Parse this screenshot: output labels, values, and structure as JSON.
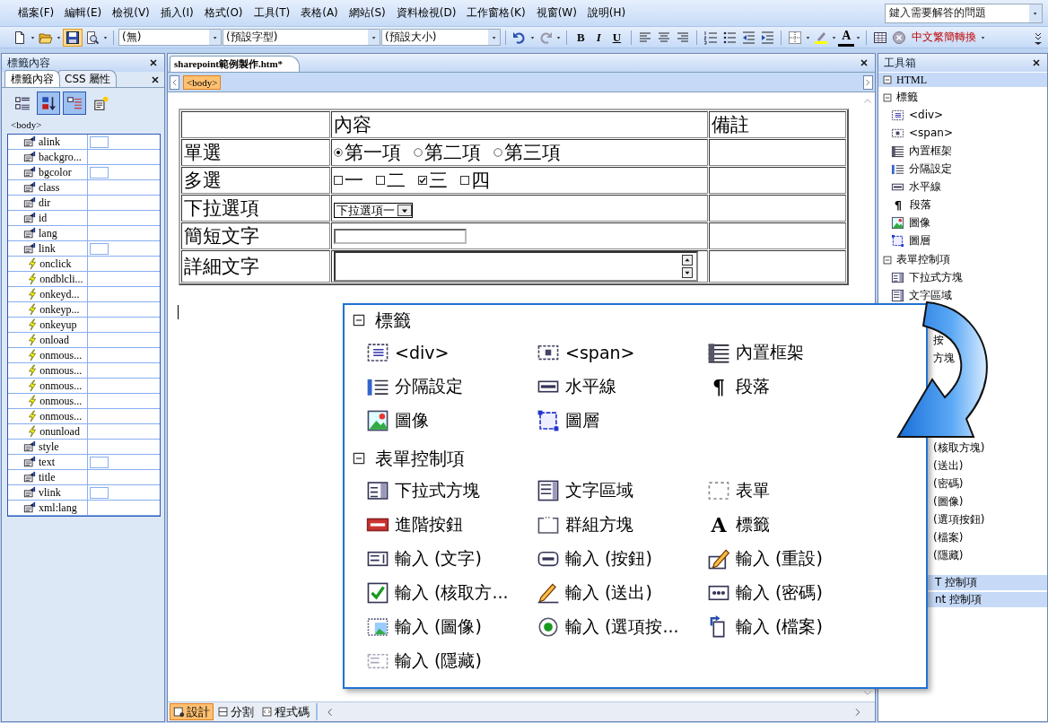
{
  "menu_bar": {
    "items": [
      "檔案(F)",
      "編輯(E)",
      "檢視(V)",
      "插入(I)",
      "格式(O)",
      "工具(T)",
      "表格(A)",
      "網站(S)",
      "資料檢視(D)",
      "工作窗格(K)",
      "視窗(W)",
      "說明(H)"
    ]
  },
  "help_search": {
    "placeholder": "鍵入需要解答的問題"
  },
  "toolbar": {
    "items": [
      {
        "kind": "new",
        "highlighted": false
      },
      {
        "kind": "caret"
      },
      {
        "kind": "open",
        "highlighted": false
      },
      {
        "kind": "caret"
      },
      {
        "kind": "save",
        "highlighted": true
      },
      {
        "kind": "preview",
        "highlighted": false
      },
      {
        "kind": "caret"
      },
      {
        "kind": "separator"
      },
      {
        "kind": "style_combo",
        "text": "(無)"
      },
      {
        "kind": "font_combo",
        "text": "(預設字型)"
      },
      {
        "kind": "size_combo",
        "text": "(預設大小)"
      },
      {
        "kind": "separator"
      },
      {
        "kind": "undo",
        "highlighted": false
      },
      {
        "kind": "caret"
      },
      {
        "kind": "redo",
        "highlighted": false
      },
      {
        "kind": "caret"
      },
      {
        "kind": "separator"
      },
      {
        "kind": "bold",
        "text": "B",
        "highlighted": false
      },
      {
        "kind": "italic",
        "text": "I",
        "highlighted": false
      },
      {
        "kind": "underline",
        "text": "U",
        "highlighted": false
      },
      {
        "kind": "separator"
      },
      {
        "kind": "align_left",
        "highlighted": false
      },
      {
        "kind": "align_center",
        "highlighted": false
      },
      {
        "kind": "align_right",
        "highlighted": false
      },
      {
        "kind": "separator"
      },
      {
        "kind": "numbering",
        "highlighted": false
      },
      {
        "kind": "bullets",
        "highlighted": false
      },
      {
        "kind": "outdent",
        "highlighted": false
      },
      {
        "kind": "indent",
        "highlighted": false
      },
      {
        "kind": "separator"
      },
      {
        "kind": "borders",
        "highlighted": false
      },
      {
        "kind": "caret"
      },
      {
        "kind": "highlight",
        "highlighted": false
      },
      {
        "kind": "caret"
      },
      {
        "kind": "font_color",
        "text": "A",
        "highlighted": false
      },
      {
        "kind": "caret"
      },
      {
        "kind": "separator"
      },
      {
        "kind": "table",
        "highlighted": false
      },
      {
        "kind": "stop",
        "highlighted": false
      },
      {
        "kind": "convert",
        "text": "中文繁簡轉換",
        "highlighted": false
      },
      {
        "kind": "caret"
      }
    ]
  },
  "tag_properties_panel": {
    "title": "標籤內容",
    "tabs": [
      {
        "label": "標籤內容",
        "selected": true
      },
      {
        "label": "CSS 屬性",
        "selected": false
      }
    ],
    "tools": [
      {
        "kind": "categorized",
        "selected": false
      },
      {
        "kind": "sort_az",
        "selected": true
      },
      {
        "kind": "show_set",
        "selected": true
      },
      {
        "kind": "tag_properties",
        "selected": false
      }
    ],
    "current_tag": "<body>",
    "properties": [
      {
        "name": "alink",
        "kind": "color"
      },
      {
        "name": "backgro...",
        "kind": "attribute"
      },
      {
        "name": "bgcolor",
        "kind": "color"
      },
      {
        "name": "class",
        "kind": "attribute"
      },
      {
        "name": "dir",
        "kind": "attribute"
      },
      {
        "name": "id",
        "kind": "attribute"
      },
      {
        "name": "lang",
        "kind": "attribute"
      },
      {
        "name": "link",
        "kind": "color"
      },
      {
        "name": "onclick",
        "kind": "event"
      },
      {
        "name": "ondblcli...",
        "kind": "event"
      },
      {
        "name": "onkeyd...",
        "kind": "event"
      },
      {
        "name": "onkeyp...",
        "kind": "event"
      },
      {
        "name": "onkeyup",
        "kind": "event"
      },
      {
        "name": "onload",
        "kind": "event"
      },
      {
        "name": "onmous...",
        "kind": "event"
      },
      {
        "name": "onmous...",
        "kind": "event"
      },
      {
        "name": "onmous...",
        "kind": "event"
      },
      {
        "name": "onmous...",
        "kind": "event"
      },
      {
        "name": "onmous...",
        "kind": "event"
      },
      {
        "name": "onunload",
        "kind": "event"
      },
      {
        "name": "style",
        "kind": "attribute"
      },
      {
        "name": "text",
        "kind": "color"
      },
      {
        "name": "title",
        "kind": "attribute"
      },
      {
        "name": "vlink",
        "kind": "color"
      },
      {
        "name": "xml:lang",
        "kind": "attribute"
      }
    ]
  },
  "document": {
    "tab": "sharepoint範例製作.htm*",
    "breadcrumb": [
      {
        "label": "<body>",
        "selected": true
      }
    ],
    "form_table": {
      "columns": [
        "內容",
        "備註"
      ],
      "rows": [
        {
          "label": "單選",
          "kind": "radio",
          "options": [
            {
              "label": "第一項",
              "selected": true
            },
            {
              "label": "第二項",
              "selected": false
            },
            {
              "label": "第三項",
              "selected": false
            }
          ]
        },
        {
          "label": "多選",
          "kind": "checkbox",
          "options": [
            {
              "label": "一",
              "checked": false
            },
            {
              "label": "二",
              "checked": false
            },
            {
              "label": "三",
              "checked": true
            },
            {
              "label": "四",
              "checked": false
            }
          ]
        },
        {
          "label": "下拉選項",
          "kind": "dropdown",
          "value": "下拉選項一"
        },
        {
          "label": "簡短文字",
          "kind": "text_input"
        },
        {
          "label": "詳細文字",
          "kind": "textarea"
        }
      ]
    },
    "view_tabs": [
      {
        "label": "設計",
        "kind": "design",
        "selected": true
      },
      {
        "label": "分割",
        "kind": "split",
        "selected": false
      },
      {
        "label": "程式碼",
        "kind": "code",
        "selected": false
      }
    ]
  },
  "toolbox": {
    "title": "工具箱",
    "sections": [
      {
        "title": "HTML",
        "expanded": true,
        "groups": [
          {
            "title": "標籤",
            "expanded": true,
            "items": [
              {
                "label": "<div>",
                "kind": "div"
              },
              {
                "label": "<span>",
                "kind": "span"
              },
              {
                "label": "內置框架",
                "kind": "iframe"
              },
              {
                "label": "分隔設定",
                "kind": "separator_set"
              },
              {
                "label": "水平線",
                "kind": "hr"
              },
              {
                "label": "段落",
                "kind": "paragraph",
                "icon_char": "¶"
              },
              {
                "label": "圖像",
                "kind": "image"
              },
              {
                "label": "圖層",
                "kind": "layer"
              }
            ]
          },
          {
            "title": "表單控制項",
            "expanded": true,
            "items": [
              {
                "label": "下拉式方塊",
                "kind": "dropdown"
              },
              {
                "label": "文字區域",
                "kind": "textarea"
              }
            ],
            "partly_hidden_upper": [
              "按",
              "方塊"
            ],
            "partly_hidden_lower": [
              "(核取方塊)",
              "(送出)",
              "(密碼)",
              "(圖像)",
              "(選項按鈕)",
              "(檔案)",
              "(隱藏)"
            ]
          }
        ]
      }
    ],
    "partly_hidden_sections": [
      "T 控制項",
      "nt 控制項"
    ]
  },
  "toolbox_zoom": {
    "groups": [
      {
        "title": "標籤",
        "expanded": true,
        "items": [
          {
            "label": "<div>",
            "kind": "div"
          },
          {
            "label": "<span>",
            "kind": "span"
          },
          {
            "label": "內置框架",
            "kind": "iframe"
          },
          {
            "label": "分隔設定",
            "kind": "separator_set"
          },
          {
            "label": "水平線",
            "kind": "hr"
          },
          {
            "label": "段落",
            "kind": "paragraph",
            "icon_char": "¶"
          },
          {
            "label": "圖像",
            "kind": "image"
          },
          {
            "label": "圖層",
            "kind": "layer"
          }
        ]
      },
      {
        "title": "表單控制項",
        "expanded": true,
        "items": [
          {
            "label": "下拉式方塊",
            "kind": "dropdown"
          },
          {
            "label": "文字區域",
            "kind": "textarea"
          },
          {
            "label": "表單",
            "kind": "form"
          },
          {
            "label": "進階按鈕",
            "kind": "advanced_button"
          },
          {
            "label": "群組方塊",
            "kind": "groupbox"
          },
          {
            "label": "標籤",
            "kind": "label",
            "icon_char": "A"
          },
          {
            "label": "輸入 (文字)",
            "kind": "input_text"
          },
          {
            "label": "輸入 (按鈕)",
            "kind": "input_button"
          },
          {
            "label": "輸入 (重設)",
            "kind": "input_reset"
          },
          {
            "label": "輸入 (核取方...",
            "kind": "input_checkbox"
          },
          {
            "label": "輸入 (送出)",
            "kind": "input_submit"
          },
          {
            "label": "輸入 (密碼)",
            "kind": "input_password"
          },
          {
            "label": "輸入 (圖像)",
            "kind": "input_image"
          },
          {
            "label": "輸入 (選項按...",
            "kind": "input_radio"
          },
          {
            "label": "輸入 (檔案)",
            "kind": "input_file"
          },
          {
            "label": "輸入 (隱藏)",
            "kind": "input_hidden"
          }
        ]
      }
    ]
  }
}
